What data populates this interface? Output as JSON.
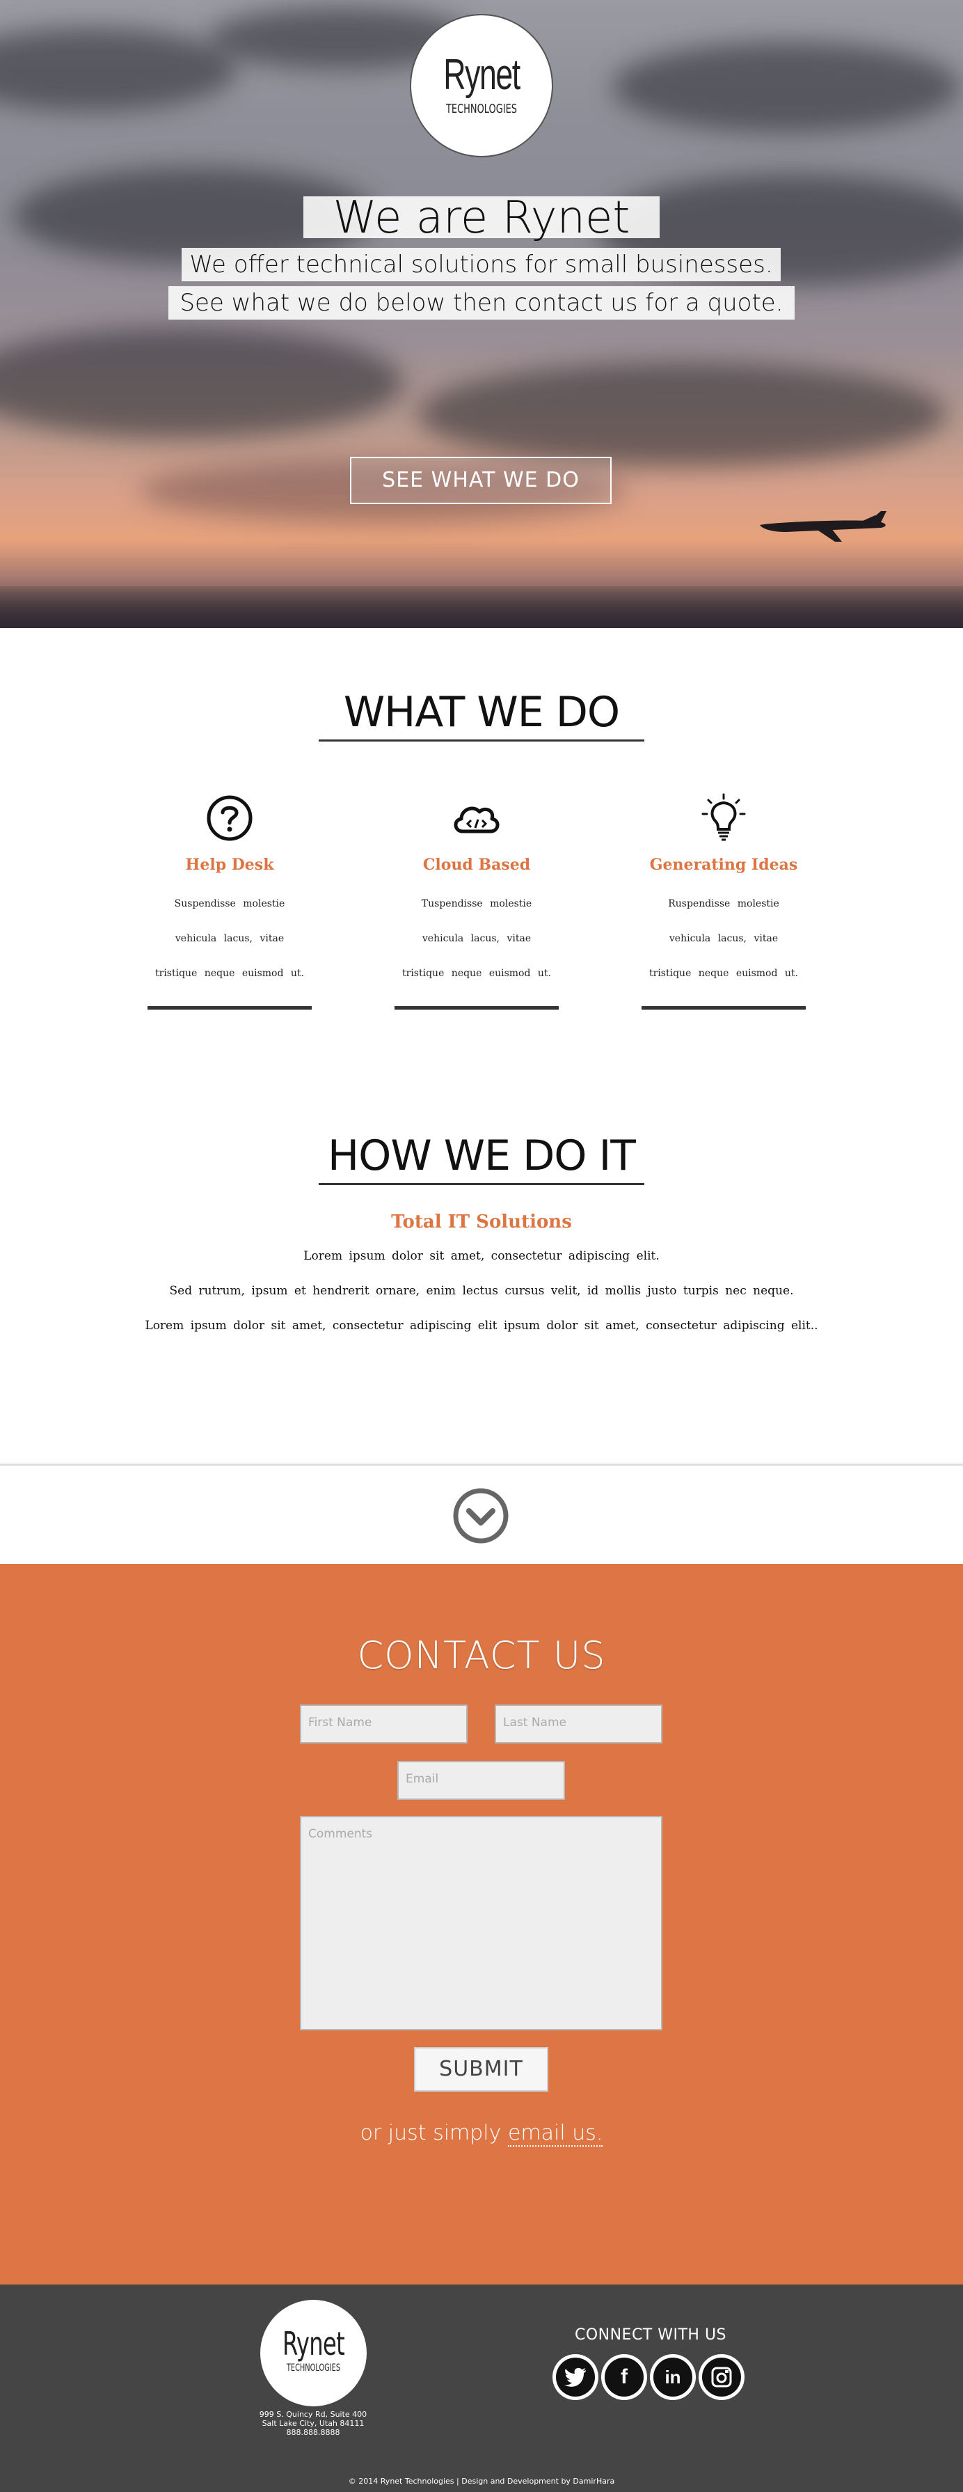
{
  "hero": {
    "logo_main": "Rynet",
    "logo_sub": "TECHNOLOGIES",
    "title": "We are Rynet",
    "subtitle_1": "We offer technical solutions for small businesses.",
    "subtitle_2": "See what we do below then contact us for a quote.",
    "cta_label": "SEE WHAT WE DO"
  },
  "what_we_do": {
    "title": "WHAT WE DO",
    "services": [
      {
        "name": "Help Desk",
        "icon": "question-icon",
        "desc": "Suspendisse molestie vehicula lacus, vitae tristique neque euismod ut."
      },
      {
        "name": "Cloud Based",
        "icon": "cloud-code-icon",
        "desc": "Tuspendisse molestie vehicula lacus, vitae tristique neque euismod ut."
      },
      {
        "name": "Generating Ideas",
        "icon": "lightbulb-icon",
        "desc": "Ruspendisse molestie vehicula lacus, vitae tristique neque euismod ut."
      }
    ]
  },
  "how_we_do_it": {
    "title": "HOW WE DO IT",
    "subtitle": "Total IT Solutions",
    "lines": [
      "Lorem ipsum dolor sit amet, consectetur adipiscing elit.",
      "Sed rutrum, ipsum et hendrerit ornare, enim lectus cursus velit, id mollis justo turpis nec neque.",
      "Lorem ipsum dolor sit amet, consectetur adipiscing elit ipsum dolor sit amet, consectetur adipiscing elit.."
    ]
  },
  "contact": {
    "title": "CONTACT US",
    "first_name_placeholder": "First Name",
    "last_name_placeholder": "Last Name",
    "email_placeholder": "Email",
    "comments_placeholder": "Comments",
    "submit_label": "SUBMIT",
    "alt_text": "or just simply",
    "alt_link": "email us."
  },
  "footer": {
    "logo_main": "Rynet",
    "logo_sub": "TECHNOLOGIES",
    "address_1": "999 S. Quincy Rd, Suite 400",
    "address_2": "Salt Lake City, Utah 84111",
    "phone": "888.888.8888",
    "connect_title": "CONNECT WITH US",
    "social": [
      "twitter-icon",
      "facebook-icon",
      "linkedin-icon",
      "instagram-icon"
    ],
    "copyright": "© 2014 Rynet Technologies | Design and Development by DamirHara"
  },
  "colors": {
    "accent": "#dd7644",
    "footer_bg": "#454545",
    "text": "#111111"
  }
}
